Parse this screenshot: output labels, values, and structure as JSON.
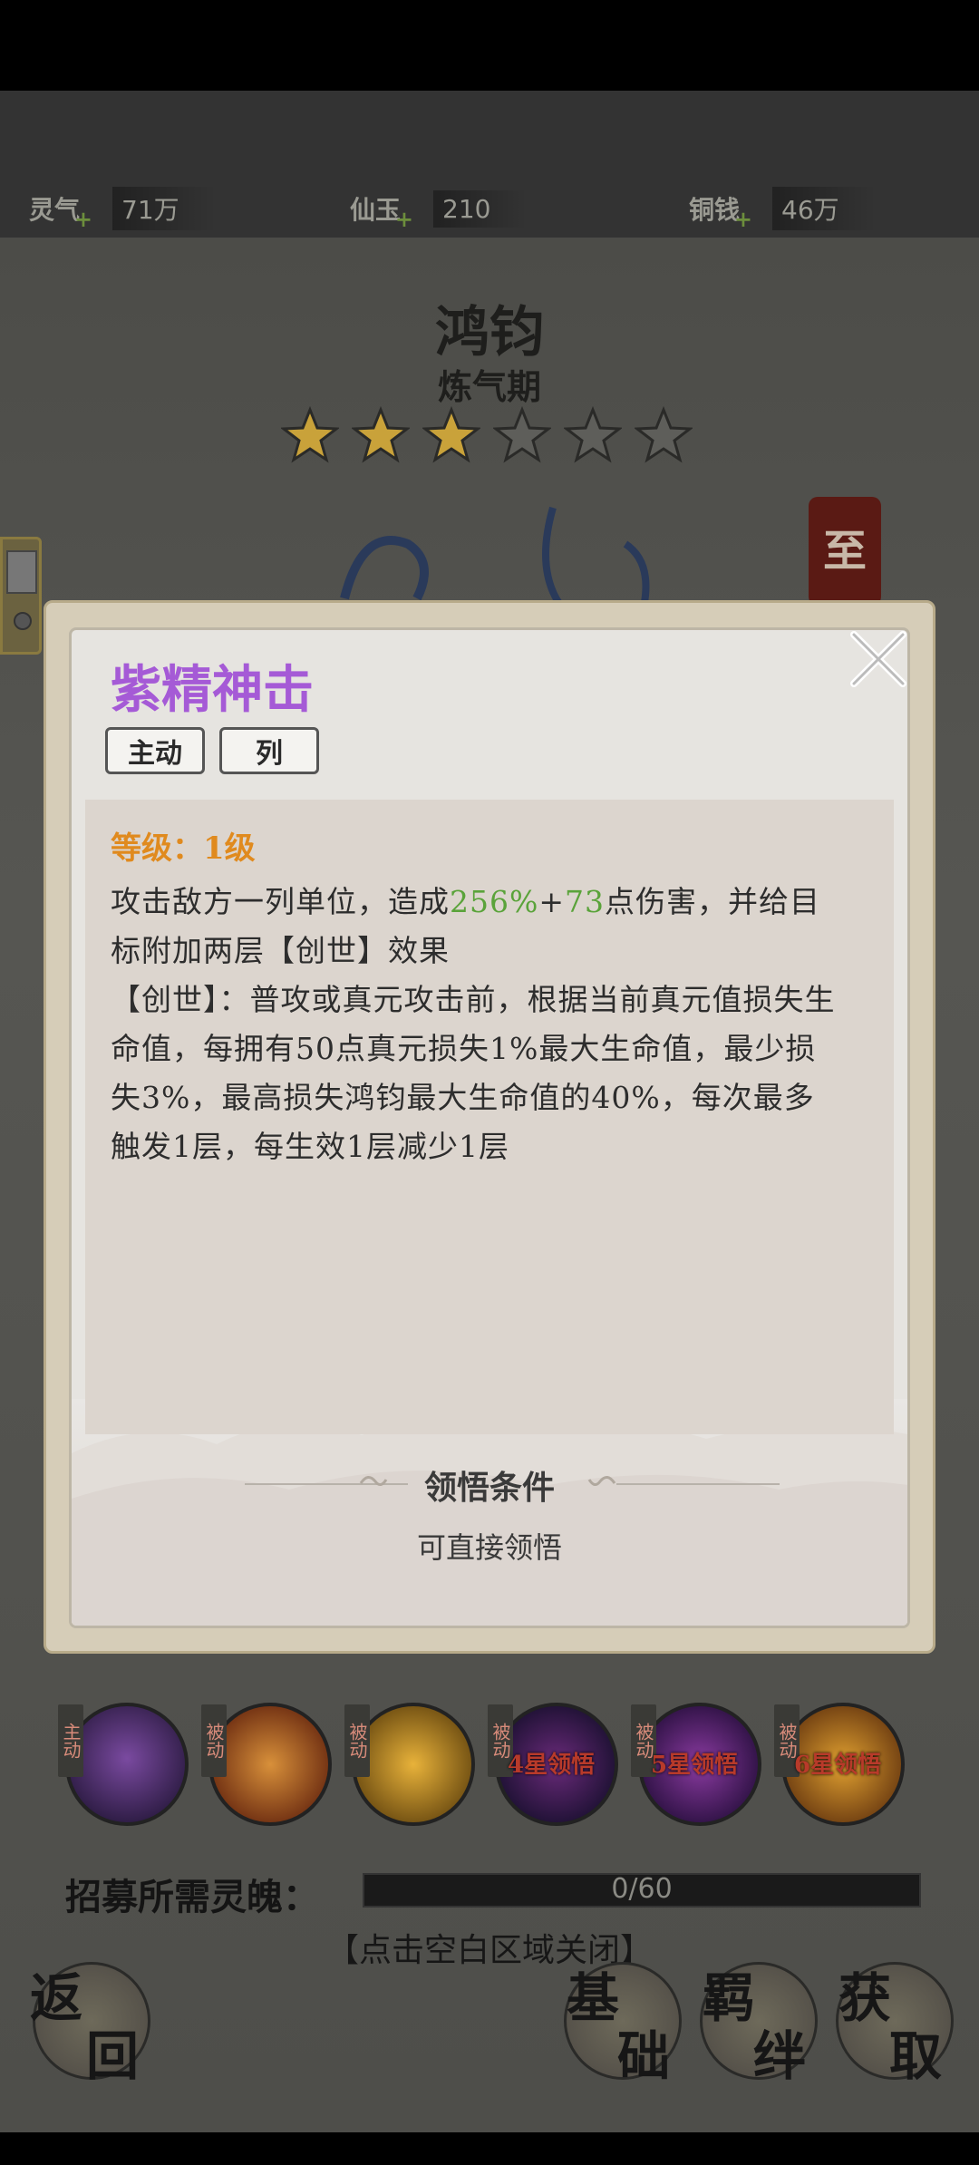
{
  "currencies": [
    {
      "label": "灵气",
      "value": "71万"
    },
    {
      "label": "仙玉",
      "value": "210"
    },
    {
      "label": "铜钱",
      "value": "46万"
    }
  ],
  "hero": {
    "name": "鸿钧",
    "realm": "炼气期",
    "stars_filled": 3,
    "stars_total": 6
  },
  "side_seal_text": "至",
  "skill_popup": {
    "title": "紫精神击",
    "tags": [
      "主动",
      "列"
    ],
    "level_text": "等级：1级",
    "desc_p1_a": "攻击敌方一列单位，造成",
    "desc_p1_pct": "256%",
    "desc_p1_plus": "+",
    "desc_p1_num": "73",
    "desc_p1_b": "点伤害，并给目标附加两层【创世】效果",
    "desc_p2": "【创世】：普攻或真元攻击前，根据当前真元值损失生命值，每拥有50点真元损失1%最大生命值，最少损失3%，最高损失鸿钧最大生命值的40%，每次最多触发1层，每生效1层减少1层",
    "condition_title": "领悟条件",
    "condition_text": "可直接领悟"
  },
  "skills_row": [
    {
      "badge": "主动",
      "lock": ""
    },
    {
      "badge": "被动",
      "lock": ""
    },
    {
      "badge": "被动",
      "lock": ""
    },
    {
      "badge": "被动",
      "lock": "4星领悟"
    },
    {
      "badge": "被动",
      "lock": "5星领悟"
    },
    {
      "badge": "被动",
      "lock": "6星领悟"
    }
  ],
  "recruit": {
    "label": "招募所需灵魄：",
    "progress": "0/60",
    "fraction": 0
  },
  "close_hint": "【点击空白区域关闭】",
  "bottom_buttons": [
    {
      "c1": "返",
      "c2": "回"
    },
    {
      "c1": "基",
      "c2": "础"
    },
    {
      "c1": "羁",
      "c2": "绊"
    },
    {
      "c1": "获",
      "c2": "取"
    }
  ],
  "colors": {
    "skill_title": "#a55ad6",
    "level_text": "#e08a1e",
    "highlight_green": "#5aa33a",
    "star_gold": "#c9a23a"
  }
}
